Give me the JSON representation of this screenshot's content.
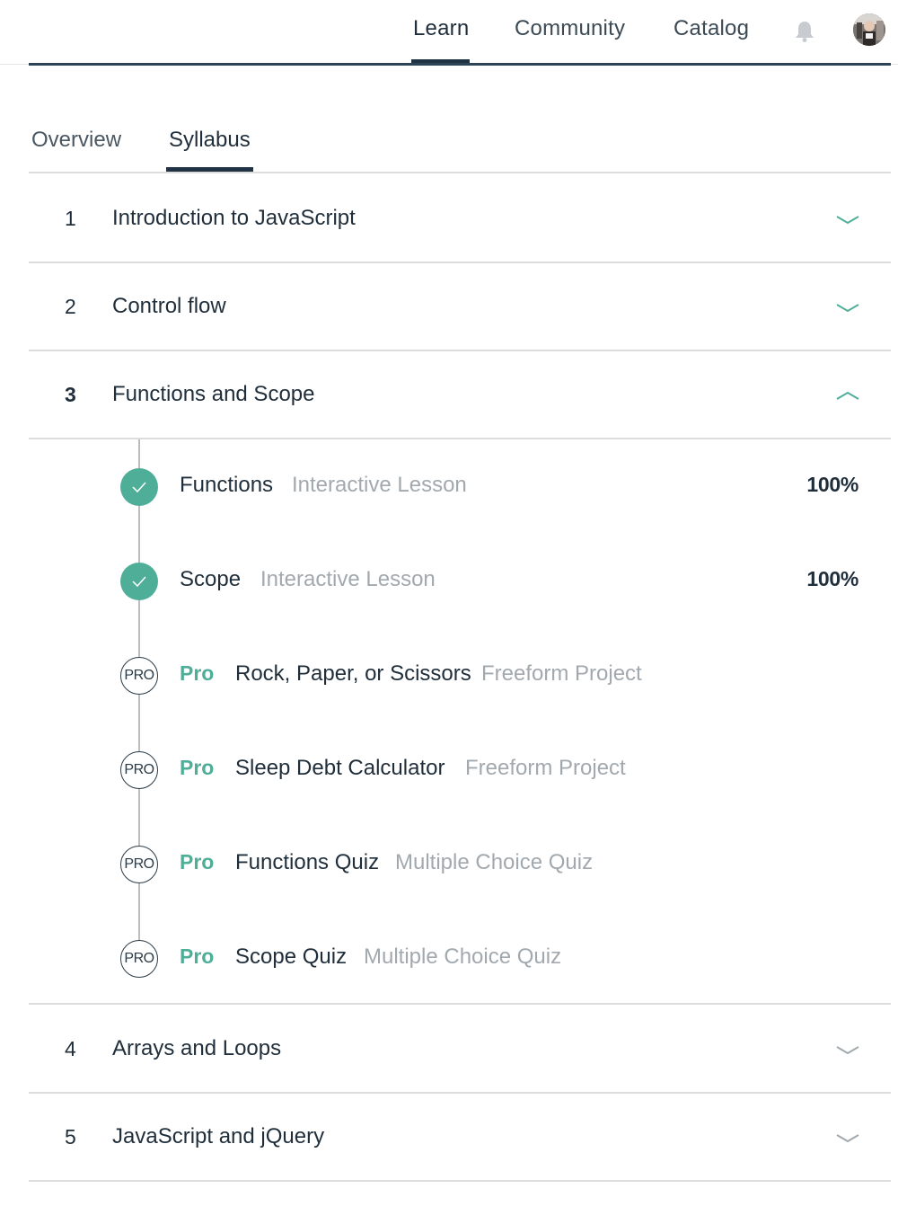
{
  "nav": {
    "items": [
      "Learn",
      "Community",
      "Catalog"
    ],
    "active": "Learn",
    "icons": [
      "bell-icon",
      "avatar"
    ]
  },
  "tabs": {
    "items": [
      "Overview",
      "Syllabus"
    ],
    "active": "Syllabus"
  },
  "sections": [
    {
      "num": "1",
      "title": "Introduction to JavaScript",
      "expanded": false
    },
    {
      "num": "2",
      "title": "Control flow",
      "expanded": false
    },
    {
      "num": "3",
      "title": "Functions and Scope",
      "expanded": true
    },
    {
      "num": "4",
      "title": "Arrays and Loops",
      "expanded": false
    },
    {
      "num": "5",
      "title": "JavaScript and jQuery",
      "expanded": false
    }
  ],
  "lessons": [
    {
      "name": "Functions",
      "type": "Interactive Lesson",
      "progress": "100%",
      "pro": false,
      "complete": true
    },
    {
      "name": "Scope",
      "type": "Interactive Lesson",
      "progress": "100%",
      "pro": false,
      "complete": true
    },
    {
      "name": "Rock, Paper, or Scissors",
      "type": "Freeform Project",
      "pro": true,
      "badge": "PRO",
      "pro_label": "Pro"
    },
    {
      "name": "Sleep Debt Calculator",
      "type": "Freeform Project",
      "pro": true,
      "badge": "PRO",
      "pro_label": "Pro"
    },
    {
      "name": "Functions Quiz",
      "type": "Multiple Choice Quiz",
      "pro": true,
      "badge": "PRO",
      "pro_label": "Pro"
    },
    {
      "name": "Scope Quiz",
      "type": "Multiple Choice Quiz",
      "pro": true,
      "badge": "PRO",
      "pro_label": "Pro"
    }
  ],
  "colors": {
    "accent_green": "#4fae98",
    "text_dark": "#1f2e3a",
    "text_muted": "#a2a9ae",
    "nav_underline": "#1f3344"
  }
}
